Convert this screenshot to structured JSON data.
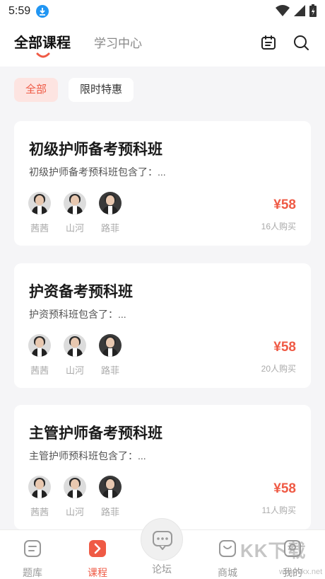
{
  "status": {
    "time": "5:59"
  },
  "header": {
    "active_tab": "全部课程",
    "secondary_tab": "学习中心",
    "icons": [
      "calendar-icon",
      "search-icon"
    ]
  },
  "filters": [
    "全部",
    "限时特惠"
  ],
  "courses": [
    {
      "title": "初级护师备考预科班",
      "desc": "初级护师备考预科班包含了：...",
      "teachers": [
        "茜茜",
        "山河",
        "路菲"
      ],
      "price": "¥58",
      "buyers": "16人购买"
    },
    {
      "title": "护资备考预科班",
      "desc": "护资预科班包含了：...",
      "teachers": [
        "茜茜",
        "山河",
        "路菲"
      ],
      "price": "¥58",
      "buyers": "20人购买"
    },
    {
      "title": "主管护师备考预科班",
      "desc": "主管护师预科班包含了：...",
      "teachers": [
        "茜茜",
        "山河",
        "路菲"
      ],
      "price": "¥58",
      "buyers": "11人购买"
    }
  ],
  "bottom_nav": {
    "items": [
      "题库",
      "课程",
      "论坛",
      "商城",
      "我的"
    ],
    "active": "课程"
  },
  "watermark": {
    "main": "KK下载",
    "sub": "www.kkx.net"
  },
  "colors": {
    "accent": "#ef5a45",
    "chip_bg": "#fde4e1",
    "download": "#2196f3"
  }
}
